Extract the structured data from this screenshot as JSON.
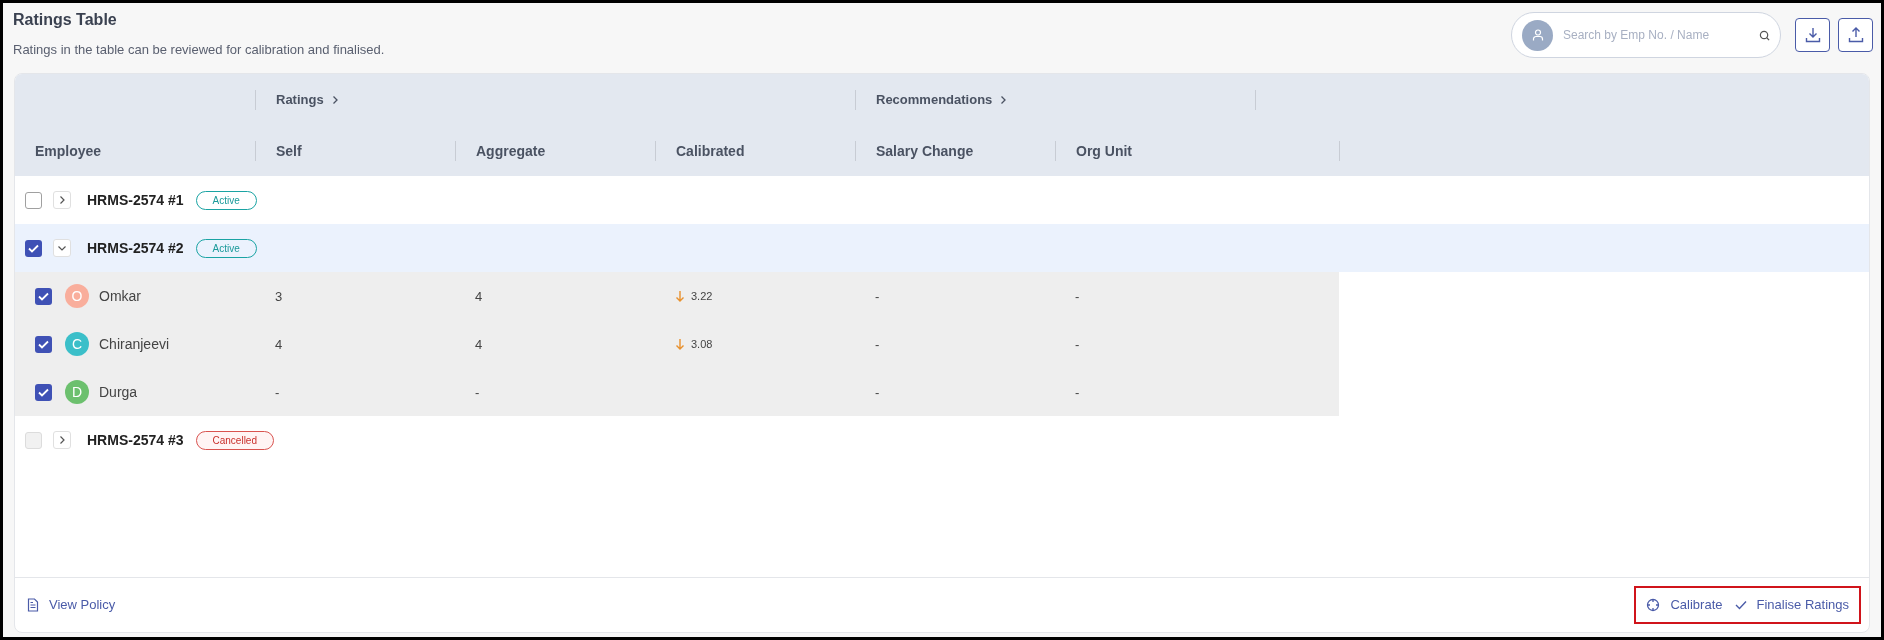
{
  "header": {
    "title": "Ratings Table",
    "subtitle": "Ratings in the table can be reviewed for calibration and finalised.",
    "search": {
      "placeholder": "Search by Emp No. / Name"
    }
  },
  "table": {
    "column_groups": [
      {
        "label": "Ratings"
      },
      {
        "label": "Recommendations"
      }
    ],
    "columns": [
      "Employee",
      "Self",
      "Aggregate",
      "Calibrated",
      "Salary Change",
      "Org Unit"
    ],
    "groups": [
      {
        "name": "HRMS-2574 #1",
        "status": "Active",
        "kind": "active",
        "checked": false,
        "disabled": false,
        "expanded": false
      },
      {
        "name": "HRMS-2574 #2",
        "status": "Active",
        "kind": "active",
        "checked": true,
        "disabled": false,
        "expanded": true,
        "children": [
          {
            "initial": "O",
            "name": "Omkar",
            "color": "#f9ae9c",
            "checked": true,
            "self": "3",
            "aggregate": "4",
            "calibrated": "3.22",
            "falling": true,
            "salary_change": "-",
            "org_unit": "-"
          },
          {
            "initial": "C",
            "name": "Chiranjeevi",
            "color": "#3bbfc9",
            "checked": true,
            "self": "4",
            "aggregate": "4",
            "calibrated": "3.08",
            "falling": true,
            "salary_change": "-",
            "org_unit": "-"
          },
          {
            "initial": "D",
            "name": "Durga",
            "color": "#6cc06e",
            "checked": true,
            "self": "-",
            "aggregate": "-",
            "salary_change": "-",
            "org_unit": "-"
          }
        ]
      },
      {
        "name": "HRMS-2574 #3",
        "status": "Cancelled",
        "kind": "cancelled",
        "checked": false,
        "disabled": true,
        "expanded": false
      }
    ]
  },
  "footer": {
    "view_policy": "View Policy",
    "actions": [
      {
        "kind": "calibrate",
        "label": "Calibrate"
      },
      {
        "kind": "finalise",
        "label": "Finalise Ratings"
      }
    ]
  }
}
